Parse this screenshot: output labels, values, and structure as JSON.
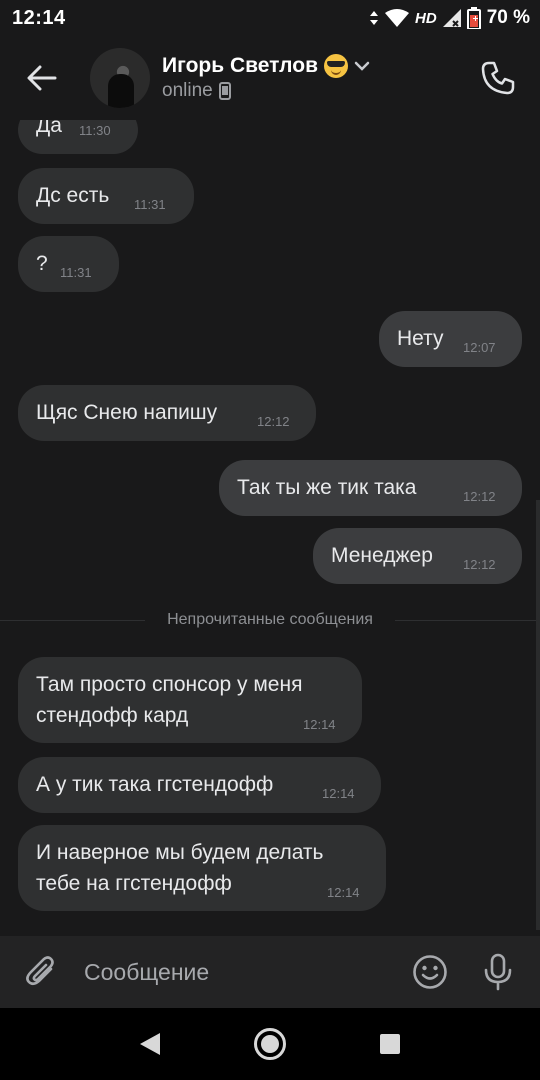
{
  "status_bar": {
    "time": "12:14",
    "network": "HD",
    "battery": "70 %"
  },
  "header": {
    "contact_name": "Игорь Светлов",
    "contact_status": "online"
  },
  "messages": [
    {
      "text": "Да",
      "time": "11:30",
      "direction": "in"
    },
    {
      "text": "Дс есть",
      "time": "11:31",
      "direction": "in"
    },
    {
      "text": "?",
      "time": "11:31",
      "direction": "in"
    },
    {
      "text": "Нету",
      "time": "12:07",
      "direction": "out"
    },
    {
      "text": "Щяс Снею напишу",
      "time": "12:12",
      "direction": "in"
    },
    {
      "text": "Так ты же тик така",
      "time": "12:12",
      "direction": "out"
    },
    {
      "text": "Менеджер",
      "time": "12:12",
      "direction": "out"
    },
    {
      "text": "Там просто спонсор у меня\nстендофф кард",
      "time": "12:14",
      "direction": "in"
    },
    {
      "text": "А у тик така ггстендофф",
      "time": "12:14",
      "direction": "in"
    },
    {
      "text": "И наверное мы будем делать\nтебе на ггстендофф",
      "time": "12:14",
      "direction": "in"
    }
  ],
  "unread_divider": "Непрочитанные сообщения",
  "composer": {
    "placeholder": "Сообщение"
  },
  "icons": {
    "back": "arrow-left-icon",
    "call": "phone-icon",
    "attach": "paperclip-icon",
    "emoji": "smile-icon",
    "mic": "microphone-icon",
    "device": "phone-device-icon",
    "nav_back": "triangle-back-icon",
    "nav_home": "circle-home-icon",
    "nav_recents": "square-recents-icon"
  },
  "colors": {
    "background": "#19191a",
    "bubble_in": "#2f3031",
    "bubble_out": "#3c3d3f",
    "text": "#e8e9eb",
    "time": "#818388"
  }
}
